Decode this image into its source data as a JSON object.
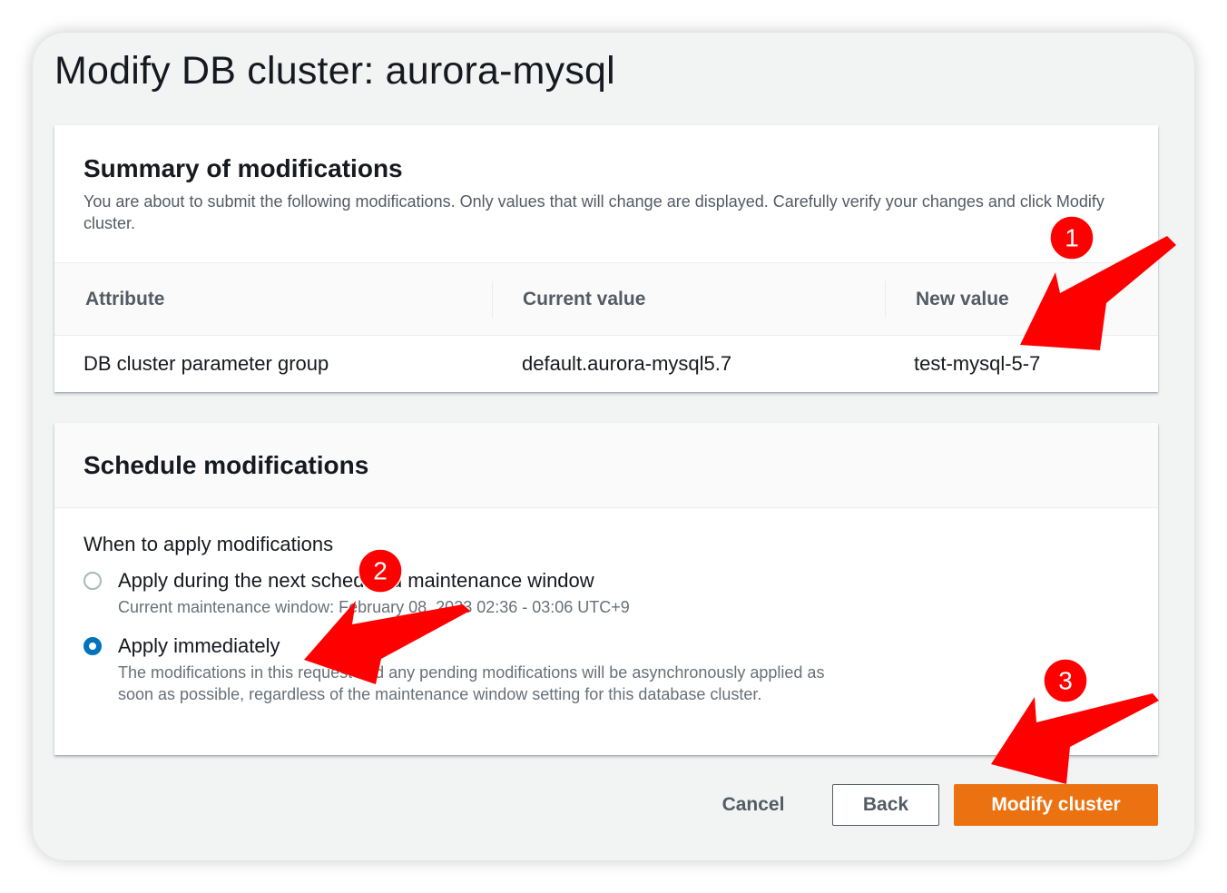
{
  "page": {
    "title": "Modify DB cluster: aurora-mysql"
  },
  "summary": {
    "title": "Summary of modifications",
    "description": "You are about to submit the following modifications. Only values that will change are displayed. Carefully verify your changes and click Modify cluster.",
    "columns": [
      "Attribute",
      "Current value",
      "New value"
    ],
    "rows": [
      {
        "attribute": "DB cluster parameter group",
        "current": "default.aurora-mysql5.7",
        "new": "test-mysql-5-7"
      }
    ]
  },
  "schedule": {
    "title": "Schedule modifications",
    "field_label": "When to apply modifications",
    "options": [
      {
        "label": "Apply during the next scheduled maintenance window",
        "description": "Current maintenance window: February 08, 2023 02:36 - 03:06 UTC+9",
        "selected": false
      },
      {
        "label": "Apply immediately",
        "description": "The modifications in this request and any pending modifications will be asynchronously applied as soon as possible, regardless of the maintenance window setting for this database cluster.",
        "selected": true
      }
    ]
  },
  "actions": {
    "cancel": "Cancel",
    "back": "Back",
    "modify": "Modify cluster"
  },
  "annotations": {
    "badges": [
      "1",
      "2",
      "3"
    ],
    "color": "#ff0000"
  },
  "colors": {
    "primary_button": "#ec7211",
    "radio_selected": "#0073bb"
  }
}
